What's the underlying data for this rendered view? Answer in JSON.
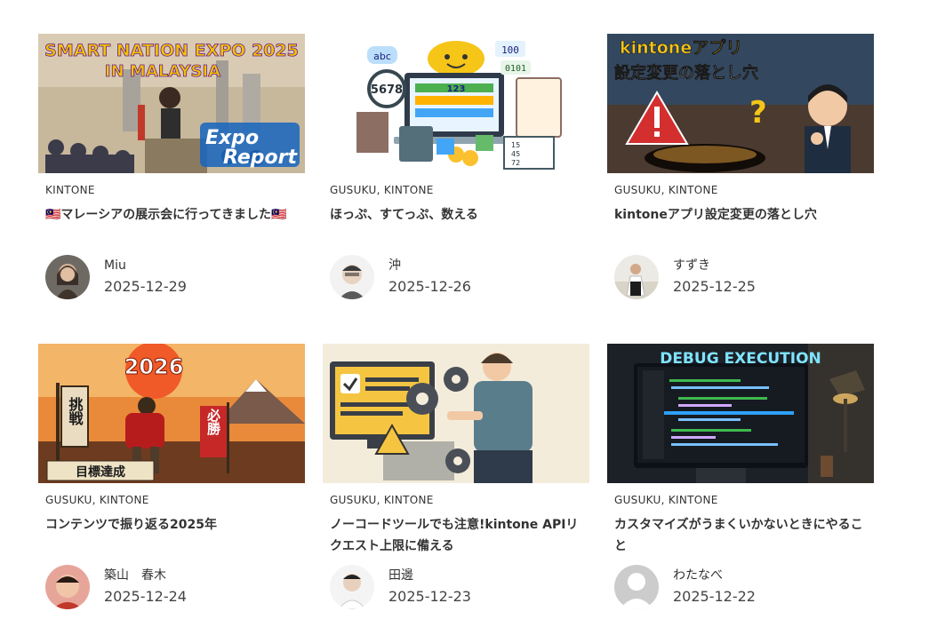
{
  "posts": [
    {
      "categories": "KINTONE",
      "title": "🇲🇾マレーシアの展示会に行ってきました🇲🇾",
      "author": "Miu",
      "date": "2025-12-29",
      "thumb_text": [
        "SMART NATION EXPO 2025",
        "IN MALAYSIA",
        "Expo",
        "Report"
      ]
    },
    {
      "categories": "GUSUKU, KINTONE",
      "title": "ほっぷ、すてっぷ、数える",
      "author": "沖",
      "date": "2025-12-26",
      "thumb_text": [
        "abc",
        "100",
        "0101",
        "5678",
        "123",
        "15",
        "45",
        "72"
      ]
    },
    {
      "categories": "GUSUKU, KINTONE",
      "title": "kintoneアプリ設定変更の落とし穴",
      "author": "すずき",
      "date": "2025-12-25",
      "thumb_text": [
        "kintoneアプリ",
        "設定変更の落とし穴",
        "?"
      ]
    },
    {
      "categories": "GUSUKU, KINTONE",
      "title": "コンテンツで振り返る2025年",
      "author": "築山　春木",
      "date": "2025-12-24",
      "thumb_text": [
        "2026",
        "挑戦",
        "必勝",
        "目標達成"
      ]
    },
    {
      "categories": "GUSUKU, KINTONE",
      "title": "ノーコードツールでも注意!kintone APIリクエスト上限に備える",
      "author": "田邊",
      "date": "2025-12-23",
      "thumb_text": []
    },
    {
      "categories": "GUSUKU, KINTONE",
      "title": "カスタマイズがうまくいかないときにやること",
      "author": "わたなべ",
      "date": "2025-12-22",
      "thumb_text": [
        "DEBUG EXECUTION"
      ]
    }
  ]
}
